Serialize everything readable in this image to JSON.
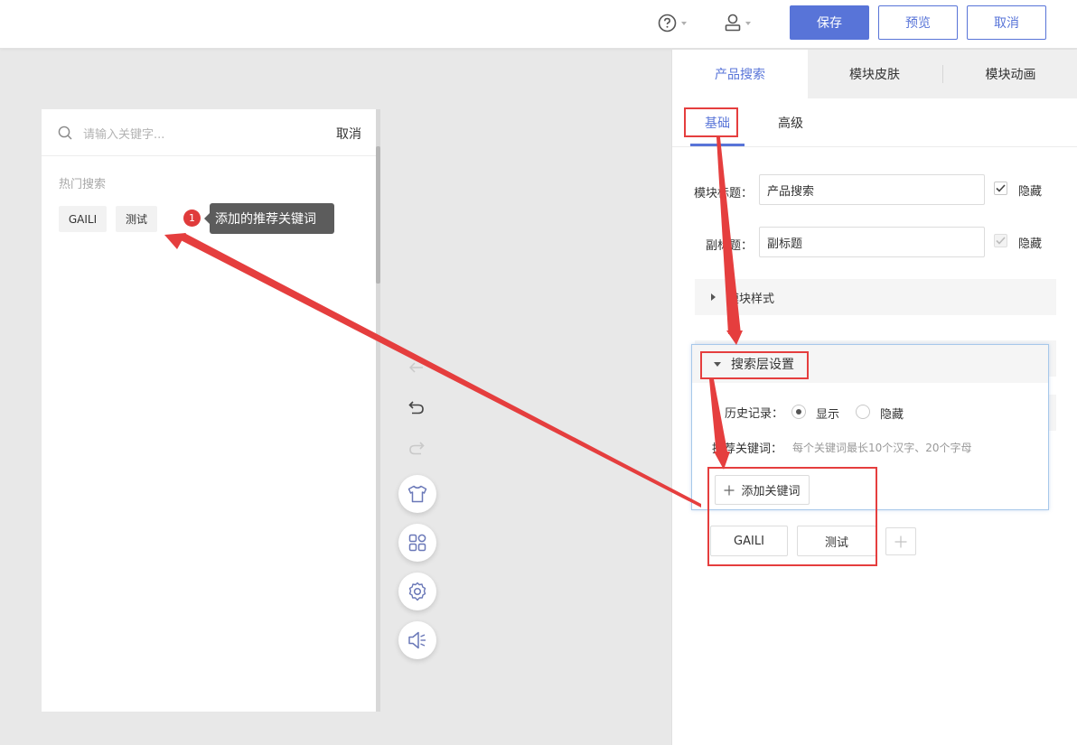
{
  "toolbar": {
    "help_icon": "question-circle-icon",
    "user_icon": "user-icon",
    "save_label": "保存",
    "preview_label": "预览",
    "cancel_label": "取消",
    "accent": "#5874d8"
  },
  "preview": {
    "search_placeholder": "请输入关键字...",
    "search_cancel": "取消",
    "hot_title": "热门搜索",
    "chips": [
      "GAILI",
      "测试"
    ],
    "badge_number": "1",
    "tooltip": "添加的推荐关键词"
  },
  "tools": {
    "icons": [
      "arrow-left-icon",
      "undo-icon",
      "redo-icon",
      "shirt-icon",
      "grid-icon",
      "settings-icon",
      "speaker-icon"
    ]
  },
  "panel": {
    "tabs": [
      "产品搜索",
      "模块皮肤",
      "模块动画"
    ],
    "active_tab": "产品搜索",
    "subtabs": [
      "基础",
      "高级"
    ],
    "active_subtab": "基础",
    "module_title_label": "模块标题：",
    "module_title_value": "产品搜索",
    "subtitle_label": "副标题：",
    "subtitle_value": "副标题",
    "hide_label_1": "隐藏",
    "hide_label_2": "隐藏",
    "module_style_label": "模块样式",
    "search_layer_label": "搜索层设置",
    "history_label": "历史记录：",
    "history_show": "显示",
    "history_hide": "隐藏",
    "recommend_label": "推荐关键词：",
    "recommend_hint": "每个关键词最长10个汉字、20个字母",
    "add_keyword_label": "添加关键词",
    "keywords": [
      "GAILI",
      "测试"
    ]
  },
  "annotation_color": "#e53e3e"
}
